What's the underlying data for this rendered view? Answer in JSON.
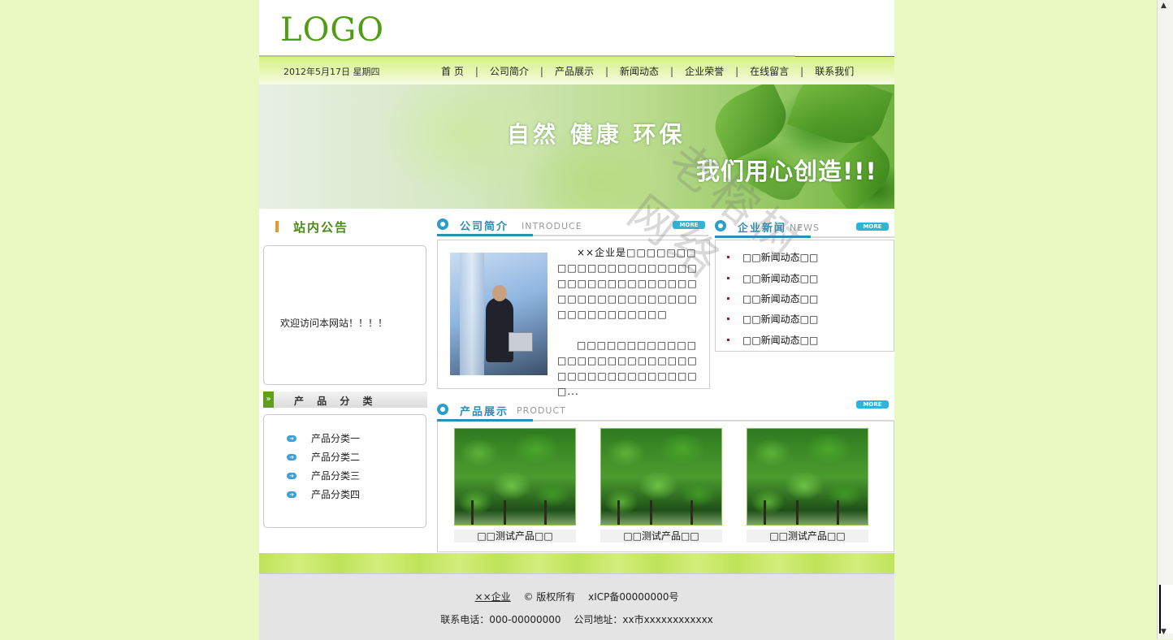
{
  "header": {
    "logo": "LOGO"
  },
  "nav": {
    "date": "2012年5月17日 星期四",
    "items": [
      "首 页",
      "公司简介",
      "产品展示",
      "新闻动态",
      "企业荣誉",
      "在线留言",
      "联系我们"
    ],
    "separator": "|"
  },
  "banner": {
    "slogan1": "自然  健康  环保",
    "slogan2": "我们用心创造!!!"
  },
  "notice": {
    "title": "站内公告",
    "message": "欢迎访问本网站！！！！"
  },
  "categories": {
    "title": "产 品 分 类",
    "items": [
      "产品分类一",
      "产品分类二",
      "产品分类三",
      "产品分类四"
    ]
  },
  "intro": {
    "title": "公司简介",
    "title_en": "INTRODUCE",
    "more": "MORE",
    "paragraph1": "××企业是□□□□□□□□□□□□□□□□□□□□□□□□□□□□□□□□□□□□□□□□□□□□□□□□□□□□□□□□□□□□",
    "paragraph2": "□□□□□□□□□□□□□□□□□□□□□□□□□□□□□□□□□□□□□□□□□..."
  },
  "news": {
    "title": "企业新闻",
    "title_en": "NEWS",
    "more": "MORE",
    "items": [
      "□□新闻动态□□",
      "□□新闻动态□□",
      "□□新闻动态□□",
      "□□新闻动态□□",
      "□□新闻动态□□"
    ]
  },
  "products": {
    "title": "产品展示",
    "title_en": "PRODUCT",
    "more": "MORE",
    "items": [
      "□□测试产品□□",
      "□□测试产品□□",
      "□□测试产品□□"
    ]
  },
  "footer": {
    "company": "××企业",
    "copyright": "© 版权所有",
    "icp": "xICP备00000000号",
    "phone": "联系电话：000-00000000",
    "address": "公司地址：xx市xxxxxxxxxxxx"
  },
  "watermark": "老榕树网络"
}
